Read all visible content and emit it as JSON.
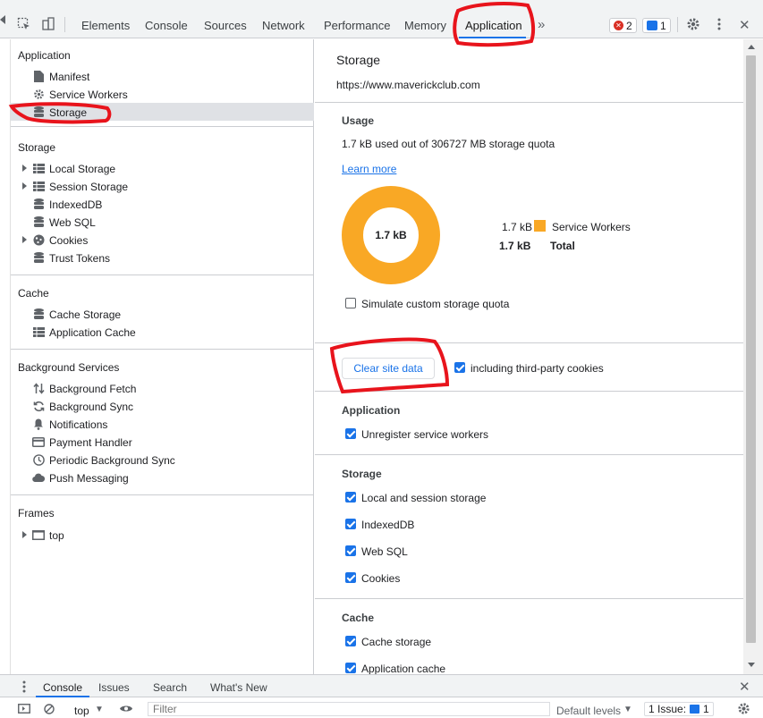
{
  "toolbar": {
    "tabs": [
      "Elements",
      "Console",
      "Sources",
      "Network",
      "Performance",
      "Memory",
      "Application"
    ],
    "active_tab": "Application",
    "more_tabs": "»",
    "error_count": "2",
    "message_count": "1",
    "close": "✕"
  },
  "sidebar": {
    "application": {
      "title": "Application",
      "items": [
        {
          "label": "Manifest",
          "icon": "file-icon"
        },
        {
          "label": "Service Workers",
          "icon": "gear-icon"
        },
        {
          "label": "Storage",
          "icon": "database-icon"
        }
      ]
    },
    "storage": {
      "title": "Storage",
      "items": [
        {
          "label": "Local Storage",
          "icon": "grid-icon"
        },
        {
          "label": "Session Storage",
          "icon": "grid-icon"
        },
        {
          "label": "IndexedDB",
          "icon": "database-icon"
        },
        {
          "label": "Web SQL",
          "icon": "database-icon"
        },
        {
          "label": "Cookies",
          "icon": "cookie-icon"
        },
        {
          "label": "Trust Tokens",
          "icon": "database-icon"
        }
      ]
    },
    "cache": {
      "title": "Cache",
      "items": [
        {
          "label": "Cache Storage",
          "icon": "database-icon"
        },
        {
          "label": "Application Cache",
          "icon": "grid-icon"
        }
      ]
    },
    "background": {
      "title": "Background Services",
      "items": [
        {
          "label": "Background Fetch",
          "icon": "arrows-updown-icon"
        },
        {
          "label": "Background Sync",
          "icon": "sync-icon"
        },
        {
          "label": "Notifications",
          "icon": "bell-icon"
        },
        {
          "label": "Payment Handler",
          "icon": "card-icon"
        },
        {
          "label": "Periodic Background Sync",
          "icon": "clock-icon"
        },
        {
          "label": "Push Messaging",
          "icon": "cloud-icon"
        }
      ]
    },
    "frames": {
      "title": "Frames",
      "items": [
        {
          "label": "top",
          "icon": "frame-icon"
        }
      ]
    }
  },
  "main": {
    "title": "Storage",
    "origin": "https://www.maverickclub.com",
    "usage": {
      "heading": "Usage",
      "summary": "1.7 kB used out of 306727 MB storage quota",
      "learn_more": "Learn more",
      "donut_label": "1.7 kB",
      "legend": [
        {
          "value": "1.7 kB",
          "label": "Service Workers",
          "color": "#f9a825"
        },
        {
          "value": "1.7 kB",
          "label": "Total"
        }
      ],
      "simulate_label": "Simulate custom storage quota",
      "simulate_checked": false
    },
    "clear": {
      "button": "Clear site data",
      "third_party_label": "including third-party cookies",
      "third_party_checked": true
    },
    "application": {
      "heading": "Application",
      "options": [
        {
          "label": "Unregister service workers",
          "checked": true
        }
      ]
    },
    "storage": {
      "heading": "Storage",
      "options": [
        {
          "label": "Local and session storage",
          "checked": true
        },
        {
          "label": "IndexedDB",
          "checked": true
        },
        {
          "label": "Web SQL",
          "checked": true
        },
        {
          "label": "Cookies",
          "checked": true
        }
      ]
    },
    "cache": {
      "heading": "Cache",
      "options": [
        {
          "label": "Cache storage",
          "checked": true
        },
        {
          "label": "Application cache",
          "checked": true
        }
      ]
    }
  },
  "drawer": {
    "tabs": [
      "Console",
      "Issues",
      "Search",
      "What's New"
    ],
    "active_tab": "Console",
    "context": "top",
    "filter_placeholder": "Filter",
    "levels": "Default levels",
    "issues_label": "1 Issue:",
    "issues_count": "1"
  },
  "colors": {
    "accent": "#1a73e8",
    "donut": "#f9a825",
    "annotation": "#e8141c"
  }
}
